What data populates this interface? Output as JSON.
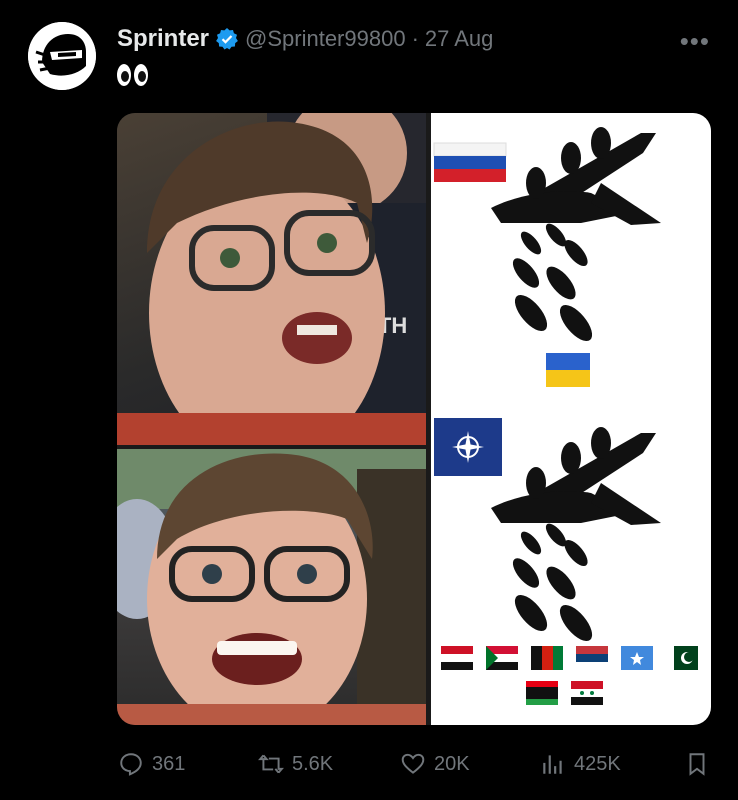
{
  "tweet": {
    "display_name": "Sprinter",
    "handle": "@Sprinter99800",
    "separator": "·",
    "date": "27 Aug",
    "more_label": "•••",
    "text_emoji": "eyes-emoji"
  },
  "media": {
    "flags_row1": [
      "iraq",
      "sudan",
      "afghanistan",
      "serbia",
      "somalia",
      "pakistan"
    ],
    "flags_row2": [
      "libya",
      "syria"
    ],
    "top_flag": "russia",
    "middle_flag": "ukraine",
    "bottom_flag": "nato",
    "shirt_text": "RTH"
  },
  "actions": {
    "replies": "361",
    "reposts": "5.6K",
    "likes": "20K",
    "views": "425K"
  },
  "colors": {
    "background": "#000000",
    "text": "#e7e9ea",
    "muted": "#71767b",
    "verified": "#1d9bf0"
  }
}
